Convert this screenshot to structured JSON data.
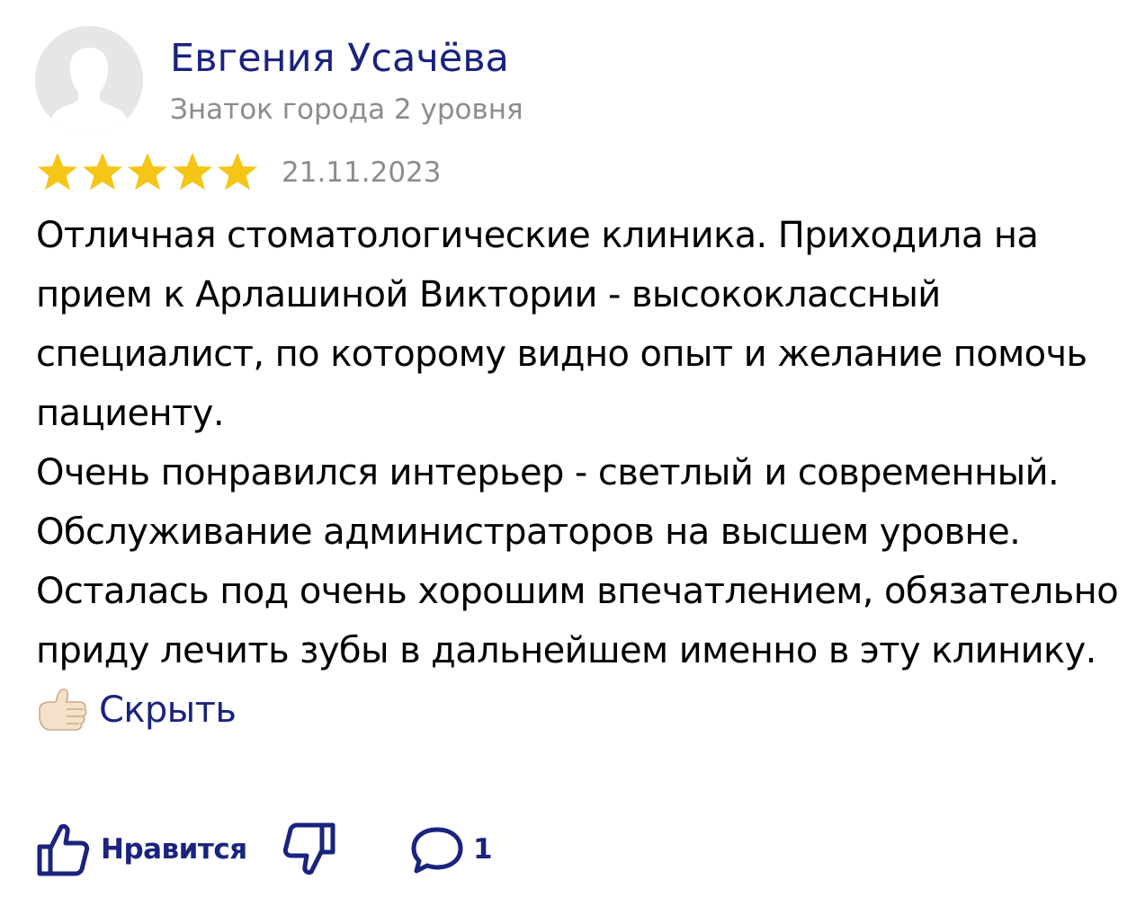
{
  "review": {
    "author": {
      "name": "Евгения Усачёва",
      "level": "Знаток города 2 уровня"
    },
    "rating": 5,
    "rating_max": 5,
    "date": "21.11.2023",
    "paragraphs": [
      "Отличная стоматологические клиника. Приходила на прием к Арлашиной Виктории - высококлассный специалист, по которому видно опыт и желание помочь пациенту.",
      "Очень понравился интерьер - светлый и современный. Обслуживание администраторов на высшем уровне.",
      "Осталась под очень хорошим впечатлением, обязательно приду лечить зубы в дальнейшем именно в эту клинику."
    ],
    "inline_emoji": "thumbs-up-emoji",
    "hide_label": "Скрыть"
  },
  "actions": {
    "like_label": "Нравится",
    "comment_count": "1"
  },
  "colors": {
    "link": "#1a237e",
    "muted_text": "#8c8c8c",
    "star": "#f5c518",
    "avatar_bg": "#e6e6e6"
  },
  "icons": {
    "avatar": "user-silhouette-icon",
    "star": "star-icon",
    "like": "thumbs-up-outline-icon",
    "dislike": "thumbs-down-outline-icon",
    "comment": "speech-bubble-icon"
  }
}
